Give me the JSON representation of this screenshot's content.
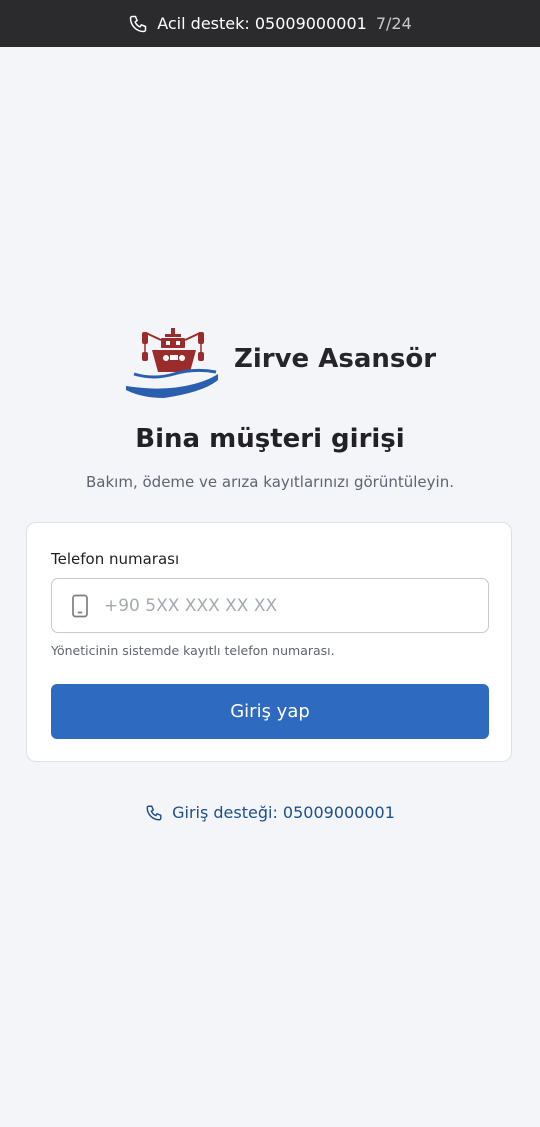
{
  "topbar": {
    "emergency_label": "Acil destek: 05009000001",
    "hours": "7/24",
    "icon": "phone-icon"
  },
  "brand": {
    "name": "Zirve Asansör",
    "logo": "ship-logo",
    "colors": {
      "red": "#9b2c2c",
      "blue": "#2a5fb0"
    }
  },
  "page": {
    "title": "Bina müşteri girişi",
    "subtitle": "Bakım, ödeme ve arıza kayıtlarınızı görüntüleyin."
  },
  "form": {
    "phone_label": "Telefon numarası",
    "phone_value": "",
    "phone_placeholder": "+90 5XX XXX XX XX",
    "phone_icon": "mobile-icon",
    "hint": "Yöneticinin sistemde kayıtlı telefon numarası.",
    "submit_label": "Giriş yap"
  },
  "support": {
    "label": "Giriş desteği: 05009000001",
    "icon": "phone-icon"
  },
  "colors": {
    "accent": "#2e6bc0",
    "link": "#1c4f8f",
    "topbar_bg": "#2b2b2d",
    "page_bg": "#f3f5f8"
  }
}
